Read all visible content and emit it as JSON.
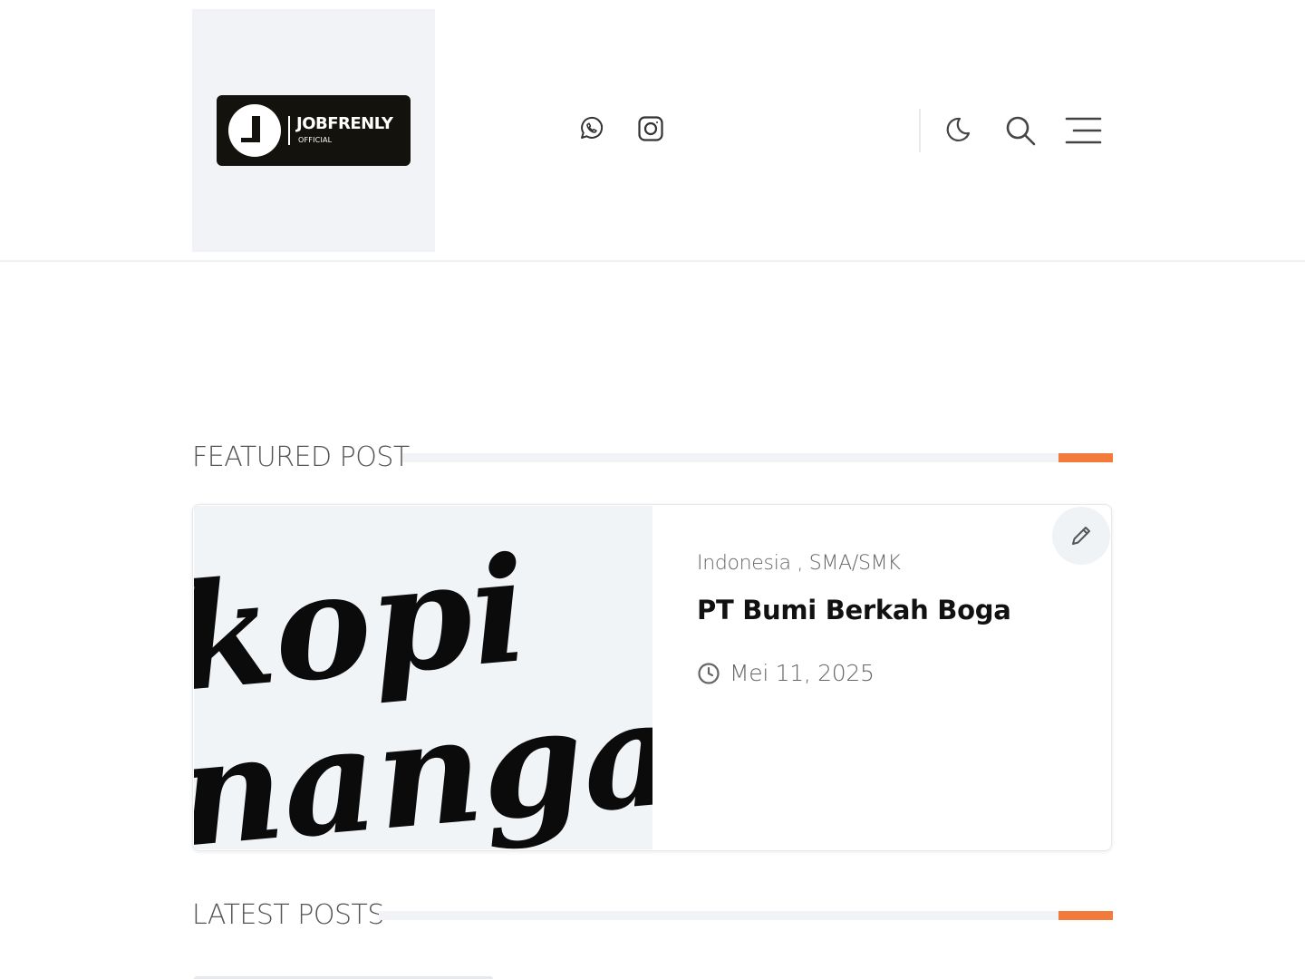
{
  "header": {
    "logo": {
      "name": "JOBFRENLY",
      "sub": "OFFICIAL"
    },
    "social": [
      {
        "icon": "whatsapp-icon"
      },
      {
        "icon": "instagram-icon"
      }
    ],
    "actions": [
      {
        "icon": "moon-icon"
      },
      {
        "icon": "search-icon"
      },
      {
        "icon": "menu-icon"
      }
    ]
  },
  "featured": {
    "heading": "FEATURED POST",
    "post": {
      "categories": "Indonesia , SMA/SMK",
      "title": "PT Bumi Berkah Boga",
      "date": "Mei 11, 2025",
      "thumbnail_text": "kopi nanga"
    }
  },
  "latest": {
    "heading": "LATEST POSTS"
  },
  "colors": {
    "accent": "#f27a3a",
    "divider": "#f1f3f6",
    "text_muted": "#666666",
    "logo_bg": "#14120d"
  }
}
